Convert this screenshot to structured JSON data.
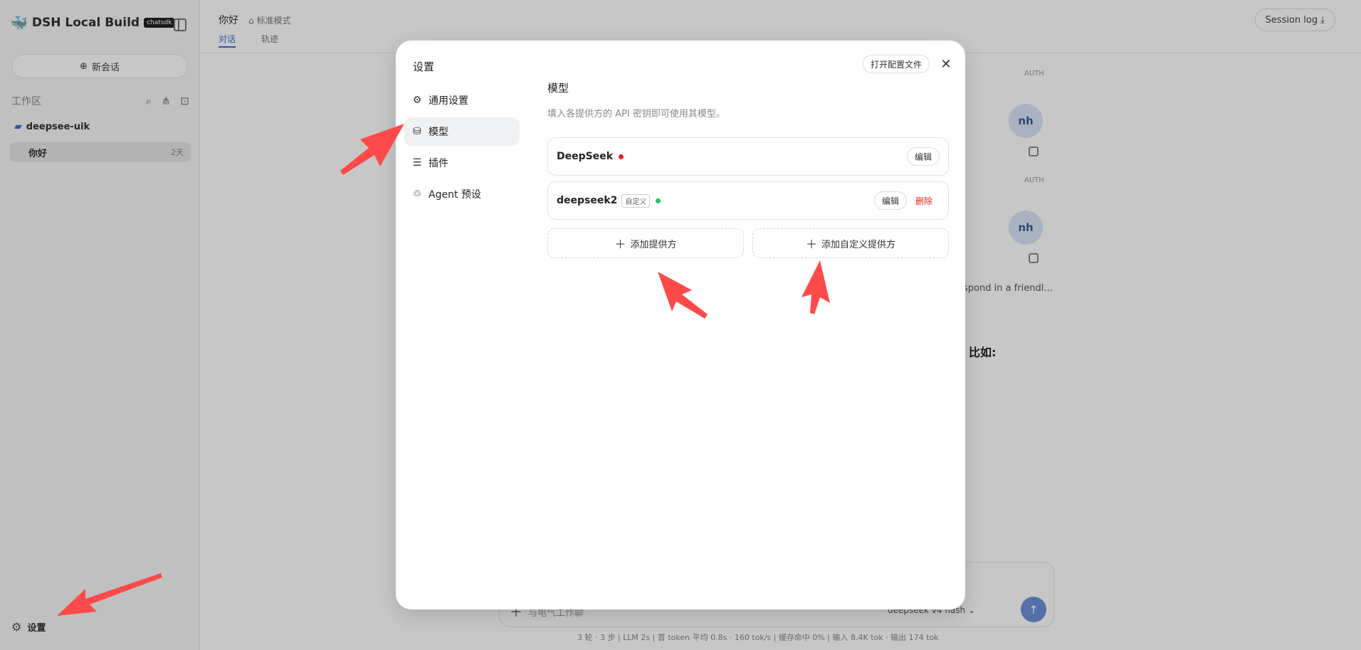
{
  "sidebar": {
    "brand": "DSH Local Build",
    "badge": "chatsdk",
    "new_chat": "新会话",
    "workspace_label": "工作区",
    "folder": "deepsee-uik",
    "session": {
      "name": "你好",
      "age": "2天"
    },
    "settings": "设置"
  },
  "main": {
    "title": "你好",
    "mode": "标准模式",
    "tabs": [
      "对话",
      "轨迹"
    ],
    "session_log": "Session log",
    "auth_label": "AUTH",
    "avatar_text": "nh",
    "response_fragment": "spond in a friendl...",
    "heading_fragment": "比如:",
    "composer": {
      "placeholder": "与电气工作聊",
      "model": "deepseek v4 flash"
    },
    "status_bar": "3 轮 · 3 步  |  LLM 2s  |  首 token 平均 0.8s · 160 tok/s  |  缓存命中 0%  |  输入 8.4K tok · 输出 174 tok"
  },
  "modal": {
    "title": "设置",
    "open_config": "打开配置文件",
    "nav": [
      {
        "label": "通用设置",
        "icon": "gear-icon"
      },
      {
        "label": "模型",
        "icon": "database-icon"
      },
      {
        "label": "插件",
        "icon": "sliders-icon"
      },
      {
        "label": "Agent 预设",
        "icon": "agent-icon"
      }
    ],
    "active_nav": "模型",
    "section_title": "模型",
    "section_desc": "填入各提供方的 API 密钥即可使用其模型。",
    "providers": [
      {
        "name": "DeepSeek",
        "status_color": "#e0281f",
        "edit": "编辑"
      },
      {
        "name": "deepseek2",
        "tag": "自定义",
        "status_color": "#22c55e",
        "edit": "编辑",
        "delete": "删除"
      }
    ],
    "add_provider": "添加提供方",
    "add_custom_provider": "添加自定义提供方"
  },
  "colors": {
    "accent": "#3b6fd6",
    "annotation": "#ff4a4a",
    "danger": "#e0281f",
    "ok": "#22c55e"
  }
}
